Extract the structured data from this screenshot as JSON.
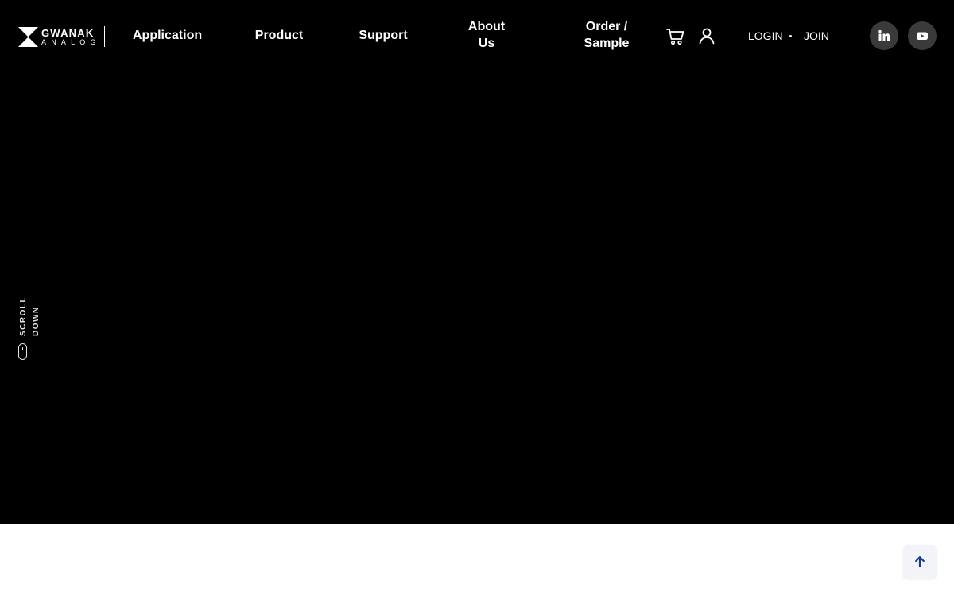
{
  "brand": {
    "name_top": "GWANAK",
    "name_bottom": "ANALOG"
  },
  "nav": {
    "application": "Application",
    "product": "Product",
    "support": "Support",
    "about_line1": "About",
    "about_line2": "Us",
    "order_line1": "Order /",
    "order_line2": "Sample"
  },
  "header_icons": [
    "cart-icon",
    "user-icon"
  ],
  "auth": {
    "login": "LOGIN",
    "join": "JOIN"
  },
  "social": [
    "linkedin-icon",
    "youtube-icon"
  ],
  "hero": {
    "scroll_label": "SCROLL DOWN"
  },
  "colors": {
    "hero_background": "#000000",
    "page_background": "#ffffff",
    "social_button": "#3a3a3a",
    "to_top_button": "#f2f4f7",
    "to_top_arrow": "#1a3a8c"
  },
  "floating": {
    "to_top_icon": "arrow-up-icon"
  }
}
